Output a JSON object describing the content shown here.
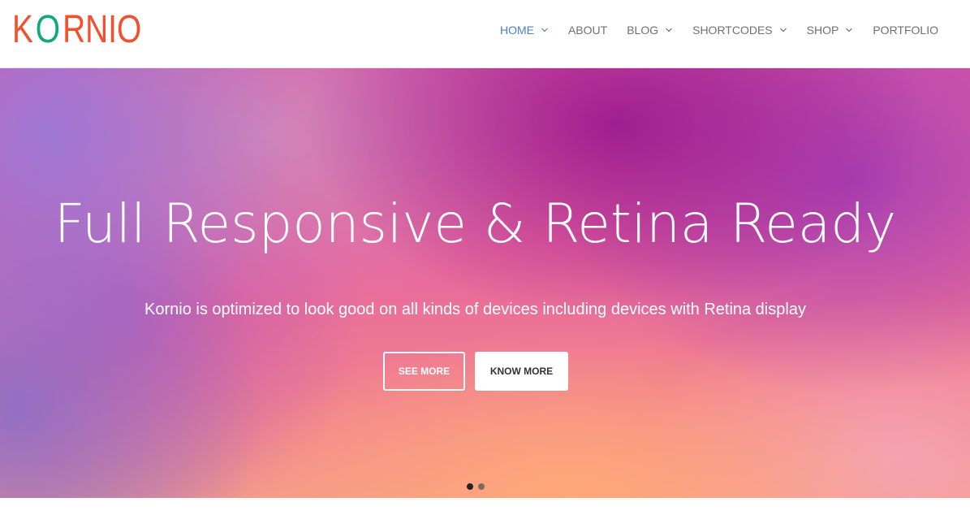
{
  "header": {
    "logo": {
      "k": "K",
      "o": "O",
      "rest": "RNIO",
      "colors": {
        "primary": "#f0512e",
        "accent": "#10a97c"
      }
    },
    "nav": [
      {
        "label": "HOME",
        "active": true,
        "has_dropdown": true
      },
      {
        "label": "ABOUT",
        "active": false,
        "has_dropdown": false
      },
      {
        "label": "BLOG",
        "active": false,
        "has_dropdown": true
      },
      {
        "label": "SHORTCODES",
        "active": false,
        "has_dropdown": true
      },
      {
        "label": "SHOP",
        "active": false,
        "has_dropdown": true
      },
      {
        "label": "PORTFOLIO",
        "active": false,
        "has_dropdown": false
      }
    ],
    "active_color": "#4c7ec2"
  },
  "hero": {
    "title": "Full Responsive & Retina Ready",
    "subtitle": "Kornio is optimized to look good on all kinds of devices including devices with Retina display",
    "buttons": {
      "see_more": "SEE MORE",
      "know_more": "KNOW MORE"
    },
    "slider": {
      "slides": 2,
      "current": 1
    }
  }
}
